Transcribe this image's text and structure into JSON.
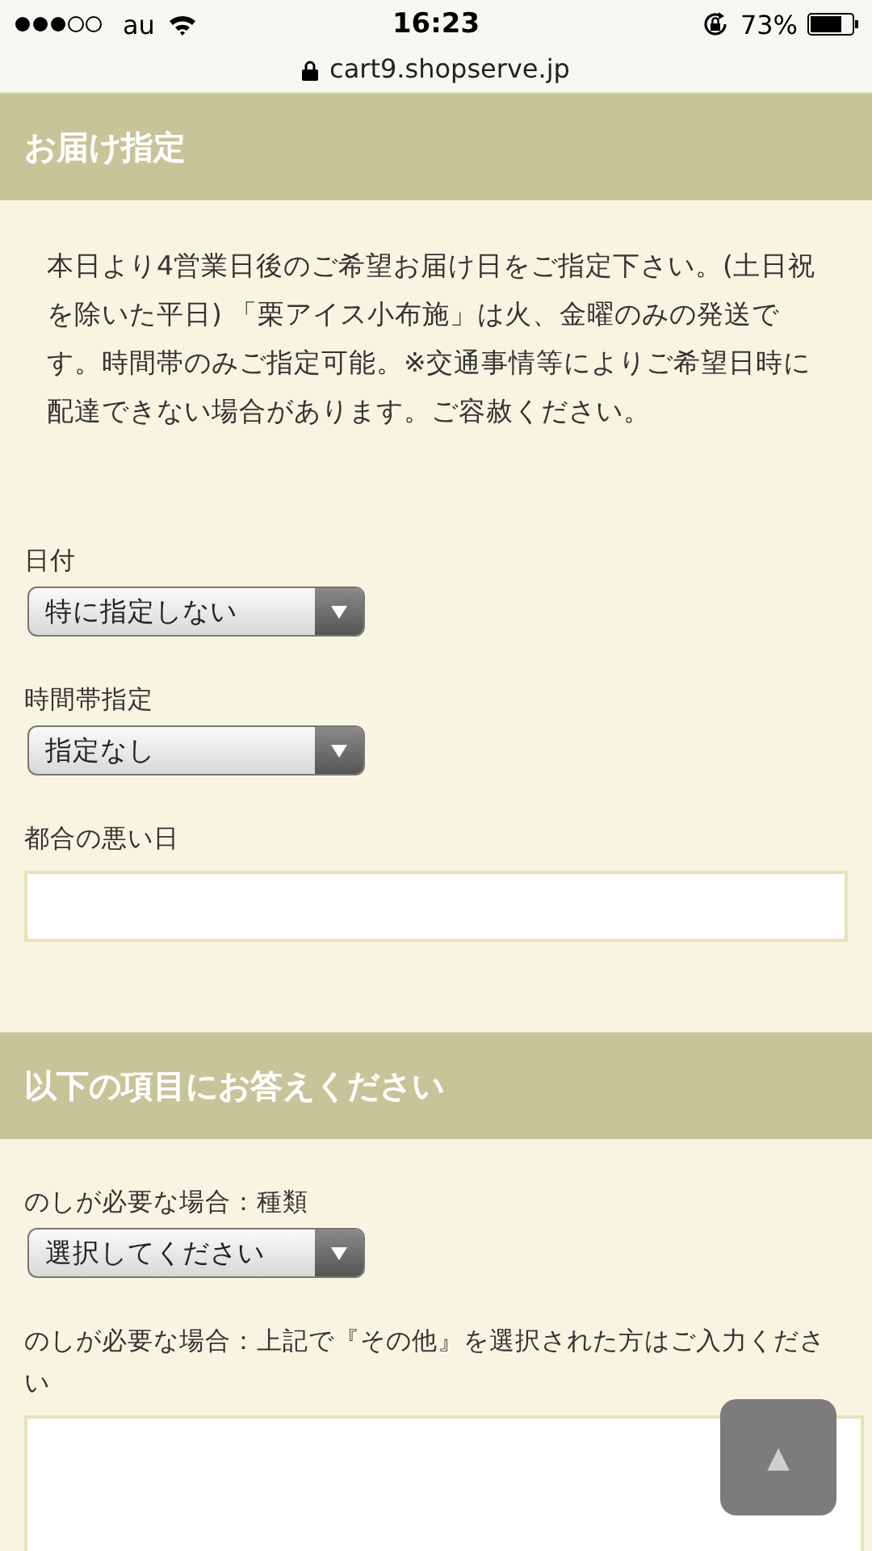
{
  "status_bar": {
    "carrier": "au",
    "time": "16:23",
    "battery": "73%"
  },
  "address_bar": {
    "url": "cart9.shopserve.jp"
  },
  "sections": [
    {
      "title": "お届け指定",
      "note": "本日より4営業日後のご希望お届け日をご指定下さい。(土日祝を除いた平日) 「栗アイス小布施」は火、金曜のみの発送です。時間帯のみご指定可能。※交通事情等によりご希望日時に配達できない場合があります。ご容赦ください。",
      "fields": [
        {
          "kind": "select",
          "label": "日付",
          "value": "特に指定しない"
        },
        {
          "kind": "select",
          "label": "時間帯指定",
          "value": "指定なし"
        },
        {
          "kind": "text",
          "label": "都合の悪い日"
        }
      ]
    },
    {
      "title": "以下の項目にお答えください",
      "fields": [
        {
          "kind": "select",
          "label": "のしが必要な場合：種類",
          "value": "選択してください"
        },
        {
          "kind": "textarea",
          "label": "のしが必要な場合：上記で『その他』を選択された方はご入力ください"
        }
      ]
    }
  ],
  "scroll_top_button": {
    "label": "▲"
  }
}
